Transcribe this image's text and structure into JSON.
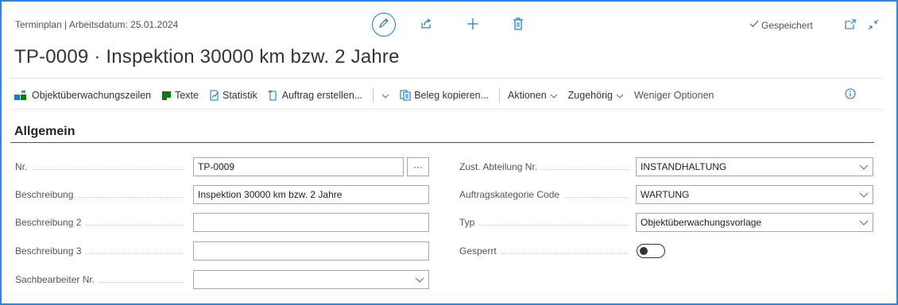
{
  "header": {
    "breadcrumb": "Terminplan | Arbeitsdatum: 25.01.2024",
    "title": "TP-0009 · Inspektion 30000 km bzw. 2 Jahre",
    "saved_status": "Gespeichert",
    "icons": [
      "edit-icon",
      "share-icon",
      "add-icon",
      "delete-icon",
      "open-new-window-icon",
      "collapse-icon"
    ]
  },
  "actions": {
    "objektueberwachungszeilen": "Objektüberwachungszeilen",
    "texte": "Texte",
    "statistik": "Statistik",
    "auftrag_erstellen": "Auftrag erstellen...",
    "beleg_kopieren": "Beleg kopieren...",
    "aktionen": "Aktionen",
    "zugehoerig": "Zugehörig",
    "weniger_optionen": "Weniger Optionen"
  },
  "section": {
    "title": "Allgemein"
  },
  "left_fields": [
    {
      "label": "Nr.",
      "value": "TP-0009"
    },
    {
      "label": "Beschreibung",
      "value": "Inspektion 30000 km bzw. 2 Jahre"
    },
    {
      "label": "Beschreibung 2",
      "value": ""
    },
    {
      "label": "Beschreibung 3",
      "value": ""
    },
    {
      "label": "Sachbearbeiter Nr.",
      "value": ""
    }
  ],
  "right_fields": [
    {
      "label": "Zust. Abteilung Nr.",
      "value": "INSTANDHALTUNG"
    },
    {
      "label": "Auftragskategorie Code",
      "value": "WARTUNG"
    },
    {
      "label": "Typ",
      "value": "Objektüberwachungsvorlage"
    },
    {
      "label": "Gesperrt",
      "value": ""
    }
  ],
  "ellipsis_label": "···",
  "gesperrt_on": false,
  "colors": {
    "accent": "#1e7ac0",
    "frame": "#2b88d8",
    "green_icon": "#107c10"
  }
}
